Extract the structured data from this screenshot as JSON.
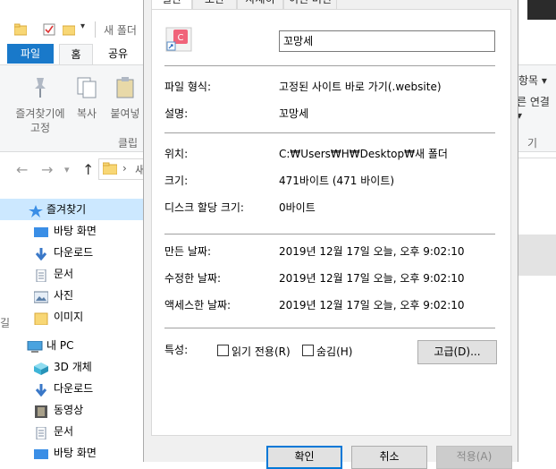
{
  "explorer": {
    "title_partial": "새 폴더",
    "tabs": {
      "file": "파일",
      "home": "홈",
      "share": "공유"
    },
    "ribbon": {
      "pin_label": "즐겨찾기에\n고정",
      "copy_label": "복사",
      "paste_label": "붙여넣",
      "group_clipboard": "클립",
      "right_item1": "항목 ▾",
      "right_item2": "른 연결 ▾",
      "right_group": "기"
    },
    "address_partial": "새",
    "tree": [
      {
        "label": "즐겨찾기",
        "icon": "star-icon",
        "selected": true
      },
      {
        "label": "바탕 화면",
        "icon": "desktop-icon"
      },
      {
        "label": "다운로드",
        "icon": "download-icon"
      },
      {
        "label": "문서",
        "icon": "document-icon"
      },
      {
        "label": "사진",
        "icon": "pictures-icon"
      },
      {
        "label": "이미지",
        "icon": "folder-icon"
      },
      {
        "label": "내 PC",
        "icon": "computer-icon"
      },
      {
        "label": "3D 개체",
        "icon": "cube-icon"
      },
      {
        "label": "다운로드",
        "icon": "download-icon"
      },
      {
        "label": "동영상",
        "icon": "video-icon"
      },
      {
        "label": "문서",
        "icon": "document-icon"
      },
      {
        "label": "바탕 화면",
        "icon": "desktop-icon"
      }
    ],
    "edge_char": "길"
  },
  "dialog": {
    "tabs": [
      "일반",
      "보안",
      "자세히",
      "이전 버전"
    ],
    "name_value": "꼬망세",
    "file_type_label": "파일 형식:",
    "file_type_value": "고정된 사이트 바로 가기(.website)",
    "desc_label": "설명:",
    "desc_value": "꼬망세",
    "location_label": "위치:",
    "location_value": "C:₩Users₩H₩Desktop₩새 폴더",
    "size_label": "크기:",
    "size_value": "471바이트 (471 바이트)",
    "disk_label": "디스크 할당 크기:",
    "disk_value": "0바이트",
    "created_label": "만든 날짜:",
    "created_value": "2019년 12월 17일 오늘, 오후 9:02:10",
    "modified_label": "수정한 날짜:",
    "modified_value": "2019년 12월 17일 오늘, 오후 9:02:10",
    "accessed_label": "액세스한 날짜:",
    "accessed_value": "2019년 12월 17일 오늘, 오후 9:02:10",
    "attr_label": "특성:",
    "readonly_label": "읽기 전용(R)",
    "hidden_label": "숨김(H)",
    "advanced_label": "고급(D)...",
    "ok_label": "확인",
    "cancel_label": "취소",
    "apply_label": "적용(A)",
    "shortcut_letter": "C",
    "colors": {
      "accent": "#0078d7",
      "shortcut_bg": "#f0637a"
    }
  }
}
